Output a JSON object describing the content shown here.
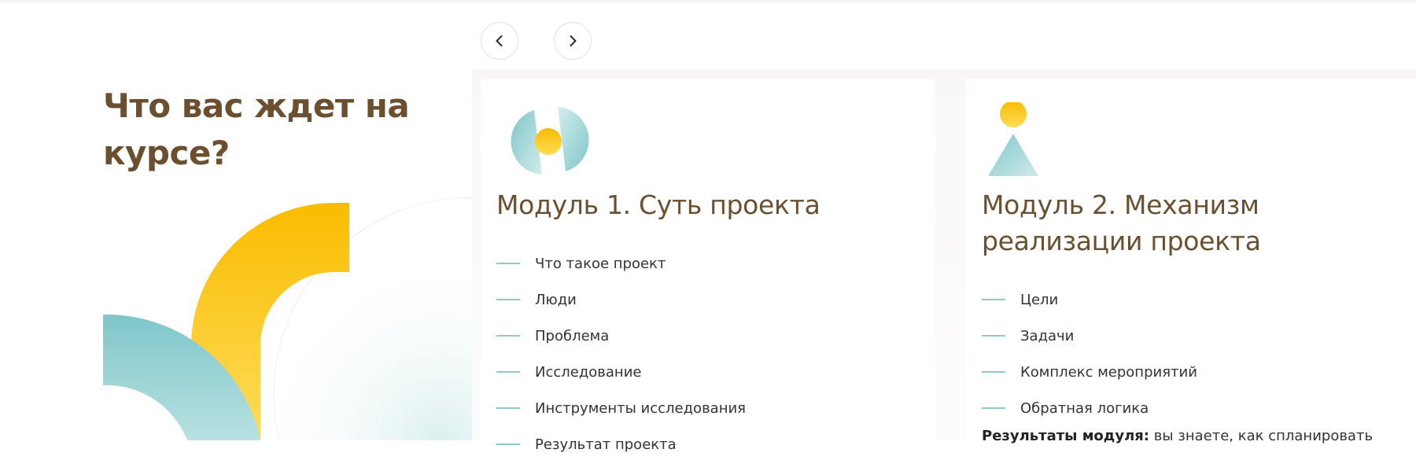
{
  "section": {
    "title": "Что вас ждет на курсе?"
  },
  "carousel": {
    "prev_icon": "chevron-left-icon",
    "next_icon": "chevron-right-icon"
  },
  "colors": {
    "brown_heading": "#6b4f2e",
    "yellow": "#f9bc00",
    "teal": "#7fc6c9",
    "dash": "#8ccbcd"
  },
  "modules": [
    {
      "title": "Модуль 1. Суть проекта",
      "icon": "split-circle-icon",
      "topics": [
        "Что такое проект",
        "Люди",
        "Проблема",
        "Исследование",
        "Инструменты исследования",
        "Результат проекта"
      ]
    },
    {
      "title": "Модуль 2. Механизм реализации проекта",
      "icon": "circle-triangle-icon",
      "topics": [
        "Цели",
        "Задачи",
        "Комплекс мероприятий",
        "Обратная логика"
      ],
      "results_label": "Результаты модуля:",
      "results_text": " вы знаете, как спланировать"
    }
  ]
}
